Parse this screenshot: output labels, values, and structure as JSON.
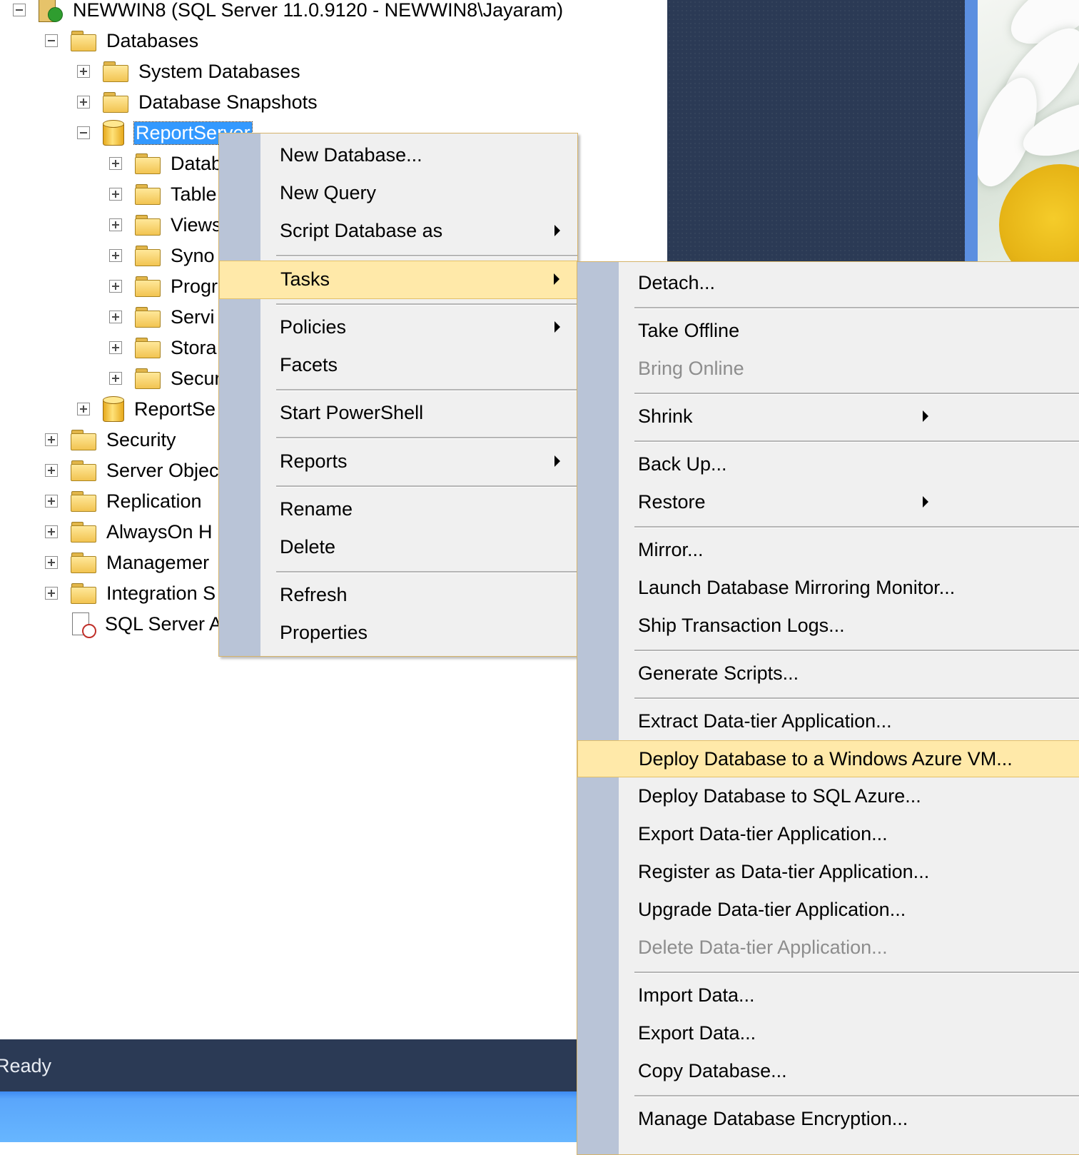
{
  "tree": {
    "server": "NEWWIN8 (SQL Server 11.0.9120 - NEWWIN8\\Jayaram)",
    "databases": "Databases",
    "system_databases": "System Databases",
    "database_snapshots": "Database Snapshots",
    "report_server": "ReportServer",
    "report_server_children": [
      "Datab",
      "Table",
      "Views",
      "Syno",
      "Progr",
      "Servi",
      "Stora",
      "Secur"
    ],
    "report_server_tempdb": "ReportSe",
    "security": "Security",
    "server_objects": "Server Objec",
    "replication": "Replication",
    "alwayson": "AlwaysOn H",
    "management": "Managemer",
    "integration": "Integration S",
    "sql_server_agent": "SQL Server A"
  },
  "context_menu": {
    "items": [
      "New Database...",
      "New Query",
      "Script Database as",
      "Tasks",
      "Policies",
      "Facets",
      "Start PowerShell",
      "Reports",
      "Rename",
      "Delete",
      "Refresh",
      "Properties"
    ]
  },
  "tasks_menu": {
    "items": [
      "Detach...",
      "Take Offline",
      "Bring Online",
      "Shrink",
      "Back Up...",
      "Restore",
      "Mirror...",
      "Launch Database Mirroring Monitor...",
      "Ship Transaction Logs...",
      "Generate Scripts...",
      "Extract Data-tier Application...",
      "Deploy Database to a Windows Azure VM...",
      "Deploy Database to SQL Azure...",
      "Export Data-tier Application...",
      "Register as Data-tier Application...",
      "Upgrade Data-tier Application...",
      "Delete Data-tier Application...",
      "Import Data...",
      "Export Data...",
      "Copy Database...",
      "Manage Database Encryption..."
    ]
  },
  "status": {
    "text": "Ready"
  },
  "colors": {
    "menu_hover": "#ffe9a9",
    "selection": "#3399ff",
    "status_bar": "#2b3a55"
  }
}
